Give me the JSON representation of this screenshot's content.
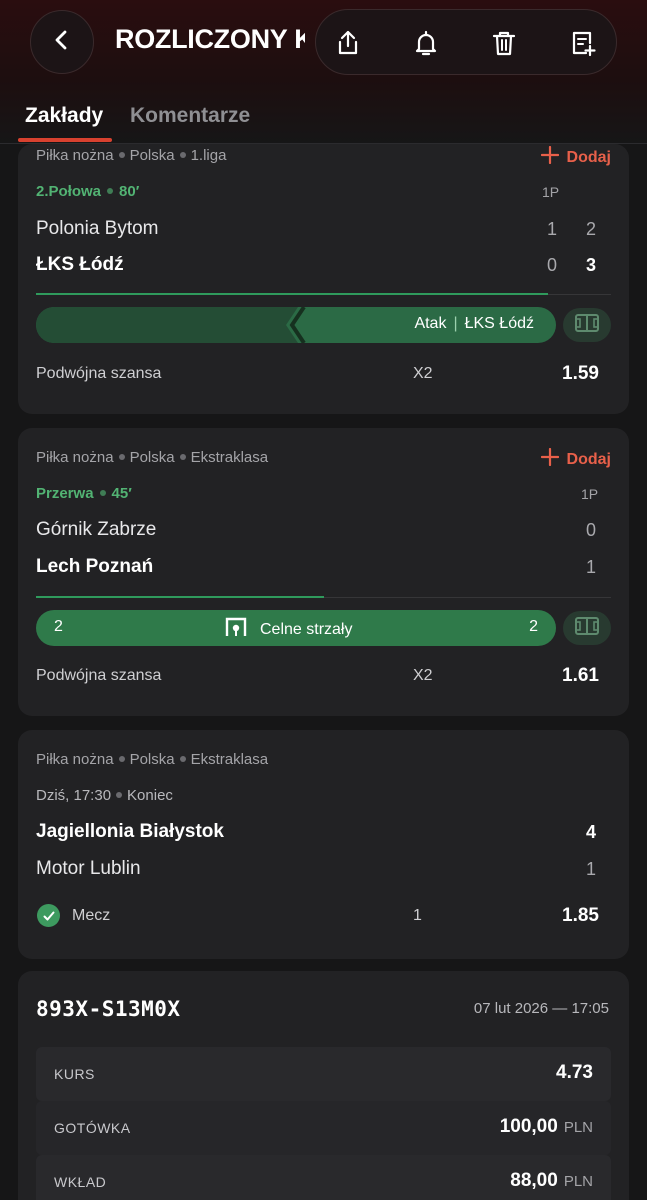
{
  "header": {
    "title": "ROZLICZONY K...",
    "icons": [
      "back-arrow-icon",
      "share-icon",
      "bell-icon",
      "trash-icon",
      "note-add-icon"
    ]
  },
  "tabs": [
    {
      "label": "Zakłady",
      "active": true
    },
    {
      "label": "Komentarze",
      "active": false
    }
  ],
  "colors": {
    "accent": "#d8412f",
    "live_green": "#52b373",
    "bar_green": "#2f7a4a",
    "add_red": "#e8604a"
  },
  "bets": [
    {
      "sport": "Piłka nożna",
      "country": "Polska",
      "league": "1.liga",
      "add_label": "Dodaj",
      "status": "2.Połowa",
      "minute": "80′",
      "period_labels": [
        "1P"
      ],
      "home": {
        "name": "Polonia Bytom",
        "scores": [
          "1",
          "2"
        ]
      },
      "away": {
        "name": "ŁKS Łódź",
        "scores": [
          "0",
          "3"
        ]
      },
      "match_progress": 0.89,
      "event": {
        "type": "Atak",
        "team": "ŁKS Łódź"
      },
      "market": "Podwójna szansa",
      "pick": "X2",
      "odds": "1.59"
    },
    {
      "sport": "Piłka nożna",
      "country": "Polska",
      "league": "Ekstraklasa",
      "add_label": "Dodaj",
      "status": "Przerwa",
      "minute": "45′",
      "period_labels": [
        "1P"
      ],
      "home": {
        "name": "Górnik Zabrze",
        "scores": [
          "0"
        ]
      },
      "away": {
        "name": "Lech Poznań",
        "scores": [
          "1"
        ]
      },
      "match_progress": 0.5,
      "event": {
        "left_value": "2",
        "label": "Celne strzały",
        "right_value": "2"
      },
      "market": "Podwójna szansa",
      "pick": "X2",
      "odds": "1.61"
    },
    {
      "sport": "Piłka nożna",
      "country": "Polska",
      "league": "Ekstraklasa",
      "time": "Dziś, 17:30",
      "state": "Koniec",
      "home": {
        "name": "Jagiellonia Białystok",
        "scores": [
          "4"
        ]
      },
      "away": {
        "name": "Motor Lublin",
        "scores": [
          "1"
        ]
      },
      "market": "Mecz",
      "pick": "1",
      "odds": "1.85",
      "won": true
    }
  ],
  "summary": {
    "code": "893X-S13M0X",
    "date": "07 lut 2026 — 17:05",
    "rows": [
      {
        "label": "KURS",
        "value": "4.73",
        "currency": ""
      },
      {
        "label": "GOTÓWKA",
        "value": "100,00",
        "currency": "PLN"
      },
      {
        "label": "WKŁAD",
        "value": "88,00",
        "currency": "PLN"
      }
    ]
  }
}
